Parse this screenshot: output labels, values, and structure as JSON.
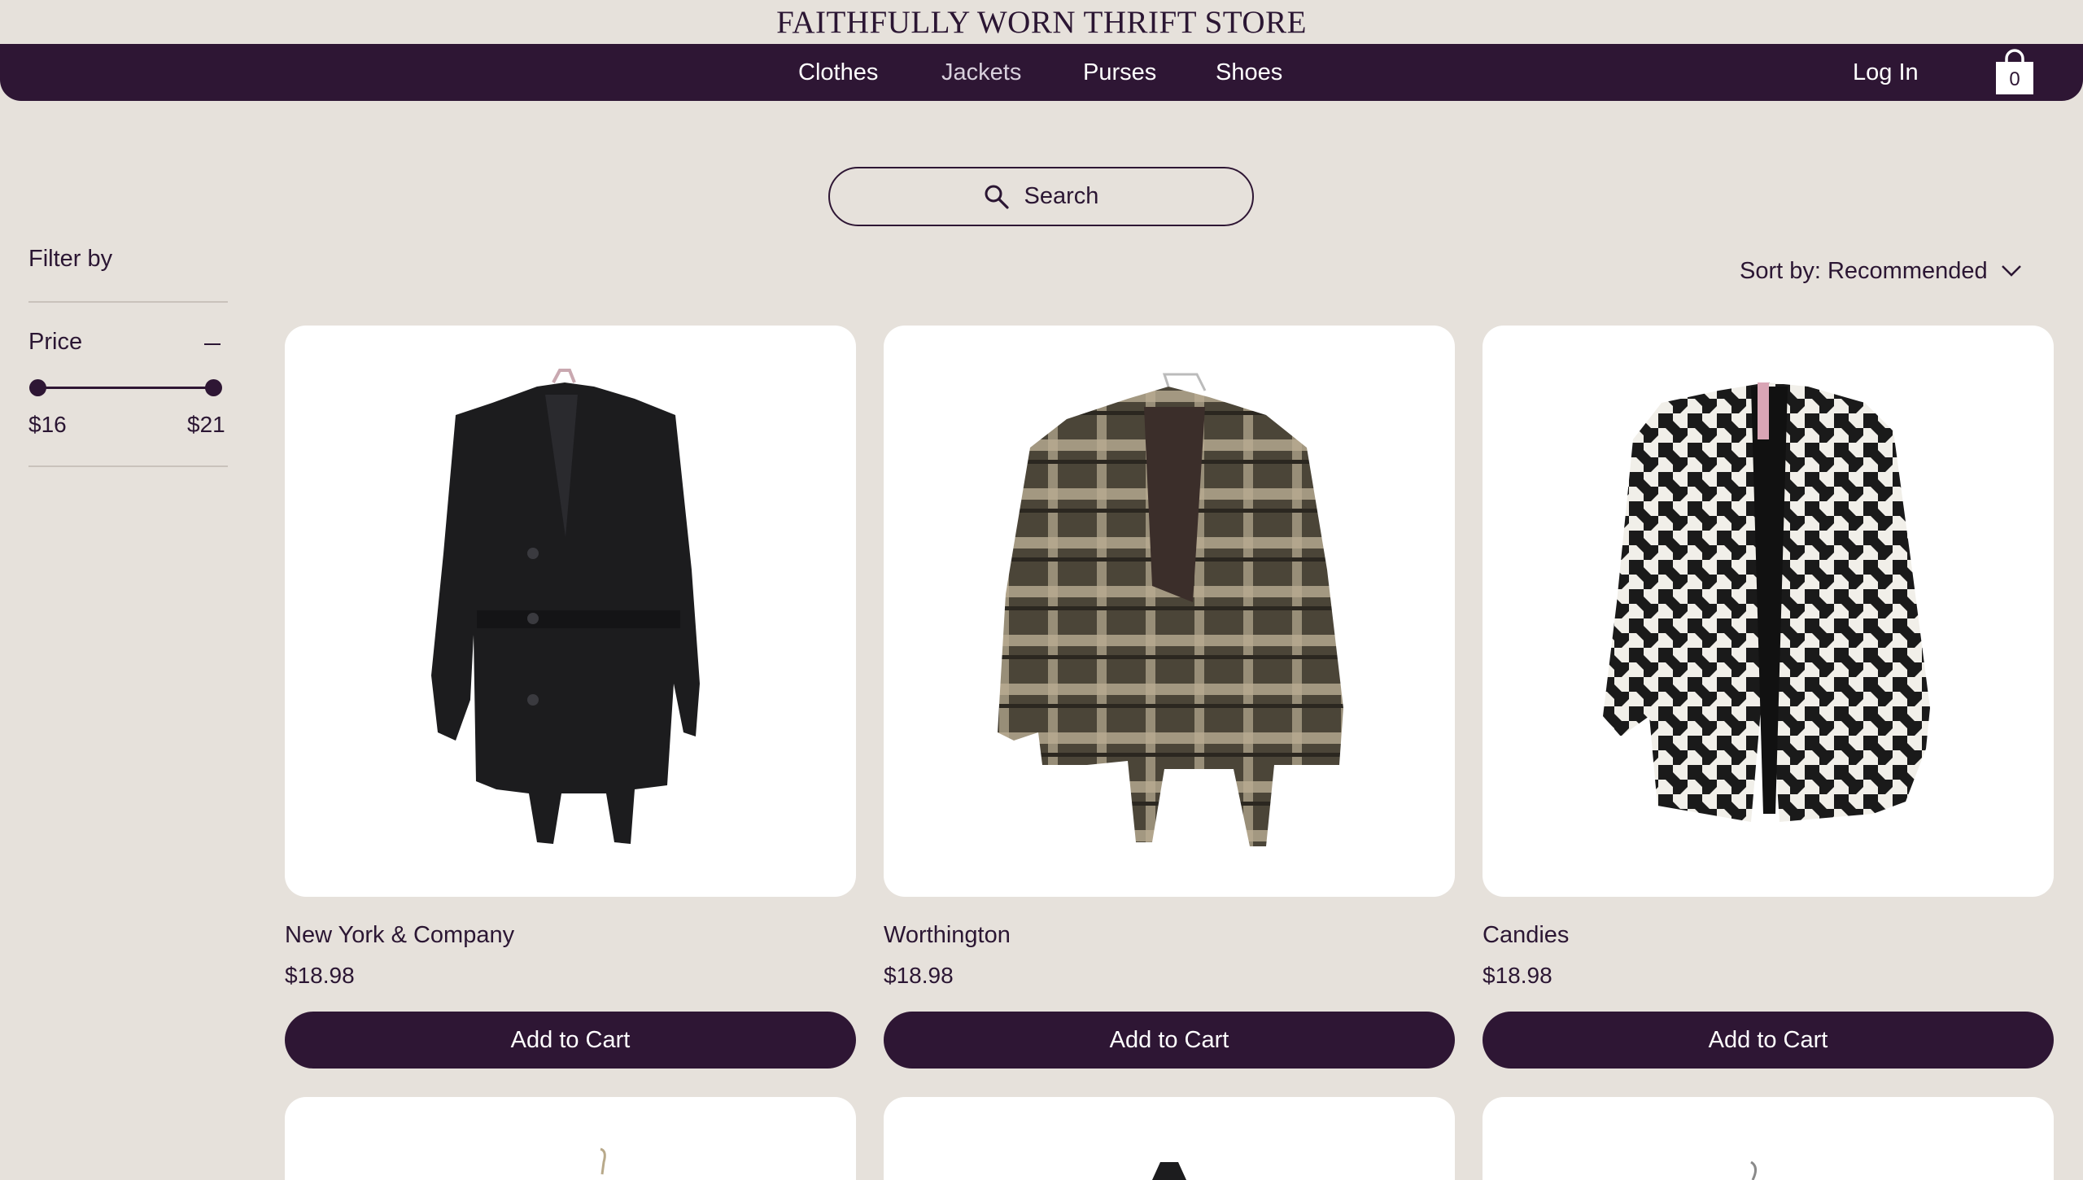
{
  "header": {
    "store_title": "FAITHFULLY WORN THRIFT STORE"
  },
  "nav": {
    "items": [
      {
        "label": "Clothes"
      },
      {
        "label": "Jackets"
      },
      {
        "label": "Purses"
      },
      {
        "label": "Shoes"
      }
    ],
    "login_label": "Log In",
    "cart_count": "0"
  },
  "search": {
    "placeholder": "Search"
  },
  "sort": {
    "label": "Sort by: Recommended"
  },
  "filter": {
    "title": "Filter by",
    "price_label": "Price",
    "price_min": "$16",
    "price_max": "$21"
  },
  "products": [
    {
      "name": "New York & Company",
      "price": "$18.98",
      "button": "Add to Cart"
    },
    {
      "name": "Worthington",
      "price": "$18.98",
      "button": "Add to Cart"
    },
    {
      "name": "Candies",
      "price": "$18.98",
      "button": "Add to Cart"
    }
  ],
  "colors": {
    "background": "#e6e1db",
    "primary": "#2e1634",
    "card": "#ffffff"
  }
}
